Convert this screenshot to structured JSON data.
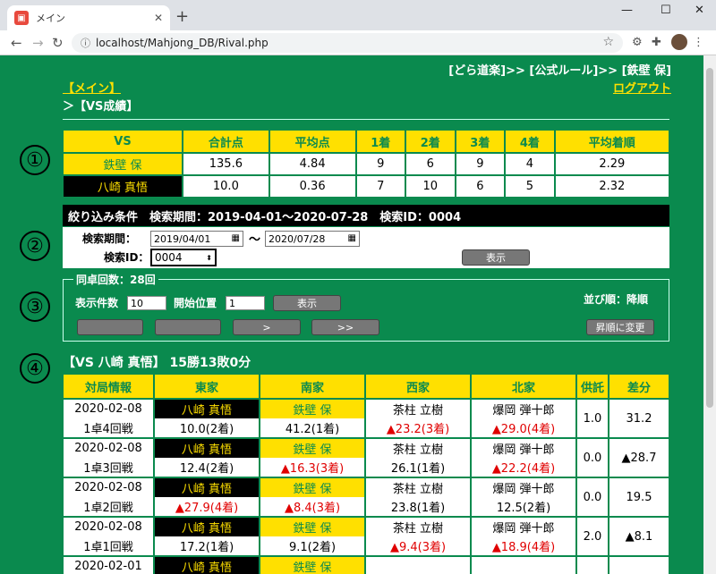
{
  "browser": {
    "tab_title": "メイン",
    "url": "localhost/Mahjong_DB/Rival.php"
  },
  "header": {
    "path": "[どら道楽]>> [公式ルール]>> [鉄壁 保]",
    "main_link": "【メイン】",
    "logout": "ログアウト",
    "breadcrumb": "＞【VS成績】"
  },
  "markers": [
    "①",
    "②",
    "③",
    "④"
  ],
  "summary": {
    "headers": [
      "VS",
      "合計点",
      "平均点",
      "1着",
      "2着",
      "3着",
      "4着",
      "平均着順"
    ],
    "rows": [
      {
        "name": "鉄壁 保",
        "cells": [
          "135.6",
          "4.84",
          "9",
          "6",
          "9",
          "4",
          "2.29"
        ]
      },
      {
        "name": "八崎 真悟",
        "cells": [
          "10.0",
          "0.36",
          "7",
          "10",
          "6",
          "5",
          "2.32"
        ]
      }
    ]
  },
  "filter": {
    "bar": "絞り込み条件　検索期間：2019-04-01～2020-07-28　検索ID：0004",
    "period_label": "検索期間：",
    "date_from": "2019/04/01",
    "tilde": "～",
    "date_to": "2020/07/28",
    "id_label": "検索ID：",
    "id_value": "0004",
    "show_button": "表示"
  },
  "paging": {
    "legend": "同卓回数：28回",
    "count_label": "表示件数",
    "count_value": "10",
    "start_label": "開始位置",
    "start_value": "1",
    "show_button": "表示",
    "next": ">",
    "last": ">>",
    "sort_label": "並び順：降順",
    "sort_button": "昇順に変更"
  },
  "results": {
    "title": "【VS 八崎 真悟】 15勝13敗0分",
    "headers": [
      "対局情報",
      "東家",
      "南家",
      "西家",
      "北家",
      "供託",
      "差分"
    ],
    "rows": [
      {
        "date": "2020-02-08",
        "game": "1卓4回戦",
        "east": {
          "name": "八崎 真悟",
          "score": "10.0(2着)",
          "neg": false,
          "style": "B"
        },
        "south": {
          "name": "鉄壁 保",
          "score": "41.2(1着)",
          "neg": false,
          "style": "Y"
        },
        "west": {
          "name": "茶柱 立樹",
          "score": "▲23.2(3着)",
          "neg": true,
          "style": ""
        },
        "north": {
          "name": "爆岡 弾十郎",
          "score": "▲29.0(4着)",
          "neg": true,
          "style": ""
        },
        "kyotaku": "1.0",
        "diff": "31.2",
        "diff_neg": false
      },
      {
        "date": "2020-02-08",
        "game": "1卓3回戦",
        "east": {
          "name": "八崎 真悟",
          "score": "12.4(2着)",
          "neg": false,
          "style": "B"
        },
        "south": {
          "name": "鉄壁 保",
          "score": "▲16.3(3着)",
          "neg": true,
          "style": "Y"
        },
        "west": {
          "name": "茶柱 立樹",
          "score": "26.1(1着)",
          "neg": false,
          "style": ""
        },
        "north": {
          "name": "爆岡 弾十郎",
          "score": "▲22.2(4着)",
          "neg": true,
          "style": ""
        },
        "kyotaku": "0.0",
        "diff": "▲28.7",
        "diff_neg": true
      },
      {
        "date": "2020-02-08",
        "game": "1卓2回戦",
        "east": {
          "name": "八崎 真悟",
          "score": "▲27.9(4着)",
          "neg": true,
          "style": "B"
        },
        "south": {
          "name": "鉄壁 保",
          "score": "▲8.4(3着)",
          "neg": true,
          "style": "Y"
        },
        "west": {
          "name": "茶柱 立樹",
          "score": "23.8(1着)",
          "neg": false,
          "style": ""
        },
        "north": {
          "name": "爆岡 弾十郎",
          "score": "12.5(2着)",
          "neg": false,
          "style": ""
        },
        "kyotaku": "0.0",
        "diff": "19.5",
        "diff_neg": false
      },
      {
        "date": "2020-02-08",
        "game": "1卓1回戦",
        "east": {
          "name": "八崎 真悟",
          "score": "17.2(1着)",
          "neg": false,
          "style": "B"
        },
        "south": {
          "name": "鉄壁 保",
          "score": "9.1(2着)",
          "neg": false,
          "style": "Y"
        },
        "west": {
          "name": "茶柱 立樹",
          "score": "▲9.4(3着)",
          "neg": true,
          "style": ""
        },
        "north": {
          "name": "爆岡 弾十郎",
          "score": "▲18.9(4着)",
          "neg": true,
          "style": ""
        },
        "kyotaku": "2.0",
        "diff": "▲8.1",
        "diff_neg": true
      },
      {
        "date": "2020-02-01",
        "game": "",
        "east": {
          "name": "八崎 真悟",
          "score": "",
          "neg": false,
          "style": "B"
        },
        "south": {
          "name": "鉄壁 保",
          "score": "",
          "neg": false,
          "style": "Y"
        },
        "west": {
          "name": "",
          "score": "",
          "neg": false,
          "style": ""
        },
        "north": {
          "name": "",
          "score": "",
          "neg": false,
          "style": ""
        },
        "kyotaku": "",
        "diff": "",
        "diff_neg": false
      }
    ]
  },
  "colors": {
    "page_bg": "#0a8a4e",
    "accent": "#ffe000",
    "negative": "#e00000"
  }
}
